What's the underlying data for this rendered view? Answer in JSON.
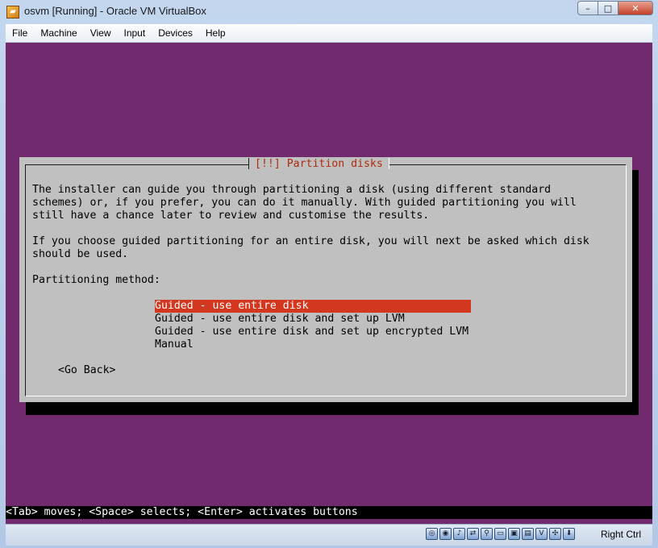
{
  "window": {
    "title": "osvm [Running] - Oracle VM VirtualBox",
    "controls": {
      "minimize": "–",
      "maximize": "□",
      "close": "✕"
    }
  },
  "menubar": {
    "items": [
      "File",
      "Machine",
      "View",
      "Input",
      "Devices",
      "Help"
    ]
  },
  "dialog": {
    "title": "[!!] Partition disks",
    "description": "The installer can guide you through partitioning a disk (using different standard\nschemes) or, if you prefer, you can do it manually. With guided partitioning you will\nstill have a chance later to review and customise the results.\n\nIf you choose guided partitioning for an entire disk, you will next be asked which disk\nshould be used.",
    "method_label": "Partitioning method:",
    "options": [
      "Guided - use entire disk",
      "Guided - use entire disk and set up LVM",
      "Guided - use entire disk and set up encrypted LVM",
      "Manual"
    ],
    "selected_index": 0,
    "go_back": "<Go Back>"
  },
  "help_line": "<Tab> moves; <Space> selects; <Enter> activates buttons",
  "statusbar": {
    "icons": [
      "hard-disk-icon",
      "optical-drive-icon",
      "audio-icon",
      "network-icon",
      "usb-icon",
      "shared-folders-icon",
      "display-icon",
      "video-capture-icon",
      "virtualization-icon",
      "mouse-integration-icon",
      "keyboard-capture-icon"
    ],
    "host_key": "Right Ctrl"
  },
  "colors": {
    "screen_bg": "#722a6e",
    "dialog_bg": "#c0c0c0",
    "selection_bg": "#d3371f",
    "title_text": "#b02a0e"
  }
}
